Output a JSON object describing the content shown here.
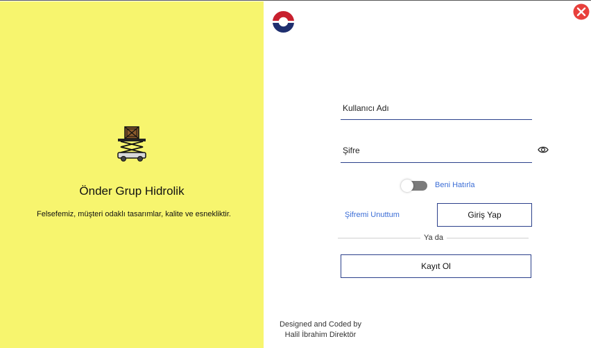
{
  "brand": {
    "title": "Önder Grup Hidrolik",
    "tagline": "Felsefemiz, müşteri odaklı tasarımlar, kalite ve esnekliktir.",
    "illustration_icon": "scissor-lift-icon",
    "logo_icon": "company-logo-icon",
    "logo_colors": {
      "top": "#c8202e",
      "bottom": "#1f2f6f"
    },
    "panel_color": "#f7f56e"
  },
  "login": {
    "username_label": "Kullanıcı Adı",
    "password_label": "Şifre",
    "show_password_icon": "eye-icon",
    "remember_label": "Beni Hatırla",
    "remember_checked": false,
    "forgot_password": "Şifremi Unuttum",
    "login_button": "Giriş Yap",
    "or_text": "Ya da",
    "register_button": "Kayıt Ol"
  },
  "window": {
    "close_icon": "close-icon",
    "close_color": "#e8403c"
  },
  "credits": {
    "line1": "Designed and Coded by",
    "line2": "Halil İbrahim Direktör"
  },
  "colors": {
    "accent": "#2a3f8a",
    "link": "#3b6dd6"
  }
}
